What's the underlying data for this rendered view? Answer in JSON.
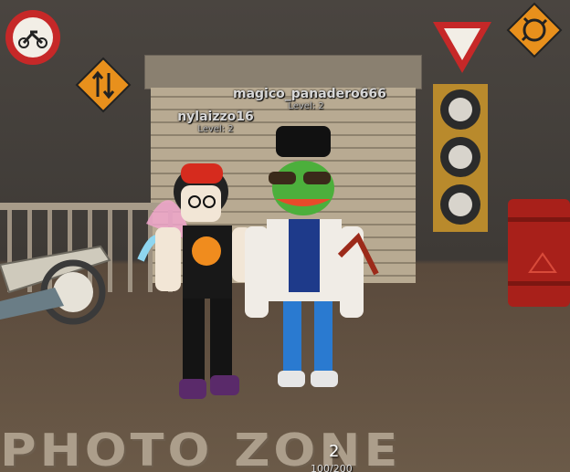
{
  "players": [
    {
      "name": "magico_panadero666",
      "level": "Level: 2"
    },
    {
      "name": "nylaizzo16",
      "level": "Level: 2"
    }
  ],
  "floor": {
    "label": "PHOTO ZONE"
  },
  "hud": {
    "count": "2",
    "health": "100/200"
  },
  "signs": {
    "motorcycle": "motorcycle-prohibited-sign-icon",
    "two_way": "two-way-traffic-sign-icon",
    "yield": "yield-sign-icon",
    "roundabout": "roundabout-sign-icon"
  },
  "colors": {
    "wall": "#4a4540",
    "floor": "#6b5a48",
    "sign_orange": "#e8901c",
    "sign_red": "#c62828",
    "barrel": "#a8201a"
  }
}
